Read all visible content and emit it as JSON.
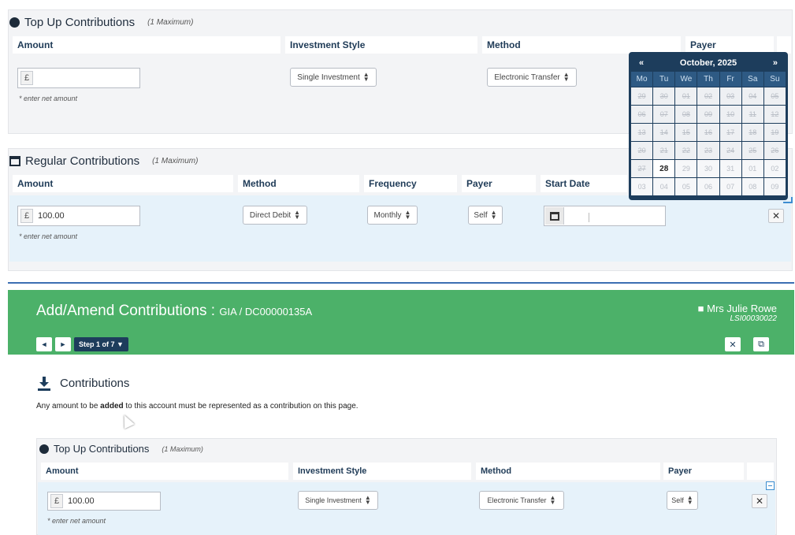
{
  "top_section_1": {
    "title": "Top Up Contributions",
    "max": "(1 Maximum)",
    "columns": [
      "Amount",
      "Investment Style",
      "Method",
      "Payer"
    ],
    "amount_currency": "£",
    "amount_value": "",
    "hint": "* enter net amount",
    "investment_style": "Single Investment",
    "method": "Electronic Transfer"
  },
  "regular_section": {
    "title": "Regular Contributions",
    "max": "(1 Maximum)",
    "columns": [
      "Amount",
      "Method",
      "Frequency",
      "Payer",
      "Start Date"
    ],
    "amount_currency": "£",
    "amount_value": "100.00",
    "hint": "* enter net amount",
    "method": "Direct Debit",
    "frequency": "Monthly",
    "payer": "Self",
    "start_date": ""
  },
  "calendar": {
    "prev": "«",
    "next": "»",
    "month": "October, 2025",
    "weekdays": [
      "Mo",
      "Tu",
      "We",
      "Th",
      "Fr",
      "Sa",
      "Su"
    ],
    "days": [
      "29",
      "30",
      "01",
      "02",
      "03",
      "04",
      "05",
      "06",
      "07",
      "08",
      "09",
      "10",
      "11",
      "12",
      "13",
      "14",
      "15",
      "16",
      "17",
      "18",
      "19",
      "20",
      "21",
      "22",
      "23",
      "24",
      "25",
      "26",
      "27",
      "28",
      "29",
      "30",
      "31",
      "01",
      "02",
      "03",
      "04",
      "05",
      "06",
      "07",
      "08",
      "09"
    ]
  },
  "banner": {
    "title": "Add/Amend Contributions : ",
    "account": "GIA / DC00000135A",
    "user_name": "Mrs Julie Rowe",
    "user_id": "LSI00030022",
    "prev": "◄",
    "next": "►",
    "step": "Step 1 of 7",
    "close": "✕",
    "save": "⧉"
  },
  "contributions": {
    "heading": "Contributions",
    "text_before": "Any amount to be ",
    "text_bold": "added",
    "text_after": " to this account must be represented as a contribution on this page."
  },
  "top_section_2": {
    "title": "Top Up Contributions",
    "max": "(1 Maximum)",
    "columns": [
      "Amount",
      "Investment Style",
      "Method",
      "Payer"
    ],
    "amount_currency": "£",
    "amount_value": "100.00",
    "hint": "* enter net amount",
    "investment_style": "Single Investment",
    "method": "Electronic Transfer",
    "payer": "Self"
  },
  "colors": {
    "banner": "#4cb169",
    "calendar": "#1d3d5c",
    "row_highlight": "#e6f2fa"
  }
}
